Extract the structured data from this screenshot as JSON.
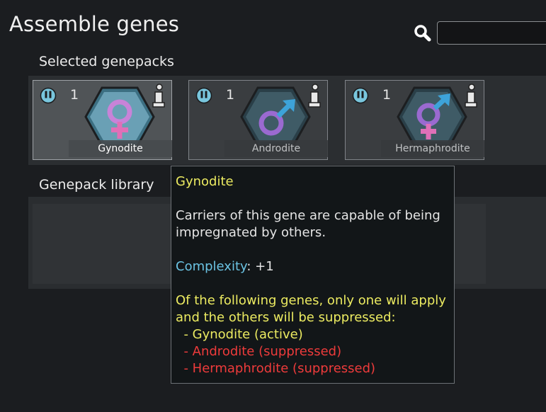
{
  "title": "Assemble genes",
  "search": {
    "placeholder": ""
  },
  "selected": {
    "heading": "Selected genepacks",
    "cards": [
      {
        "name": "Gynodite",
        "complexity": "1",
        "icon": "female-symbol-icon"
      },
      {
        "name": "Androdite",
        "complexity": "1",
        "icon": "male-symbol-icon"
      },
      {
        "name": "Hermaphrodite",
        "complexity": "1",
        "icon": "hermaphrodite-symbol-icon"
      }
    ]
  },
  "library": {
    "heading": "Genepack library"
  },
  "tooltip": {
    "title": "Gynodite",
    "description": "Carriers of this gene are capable of being impregnated by others.",
    "complexity_label": "Complexity",
    "complexity_value": ": +1",
    "exclusive_note": "Of the following genes, only one will apply and the others will be suppressed:",
    "genes": [
      "  - Gynodite (active)",
      "  - Androdite (suppressed)",
      "  - Hermaphrodite (suppressed)"
    ]
  },
  "colors": {
    "accent_yellow": "#eceb61",
    "accent_cyan": "#6bc3e3",
    "suppressed_red": "#ee3b3b",
    "symbol_female": "#c883d8",
    "symbol_male": "#3da3d9",
    "symbol_female_purple": "#9a6ad0",
    "symbol_cross_pink": "#e070b8"
  }
}
